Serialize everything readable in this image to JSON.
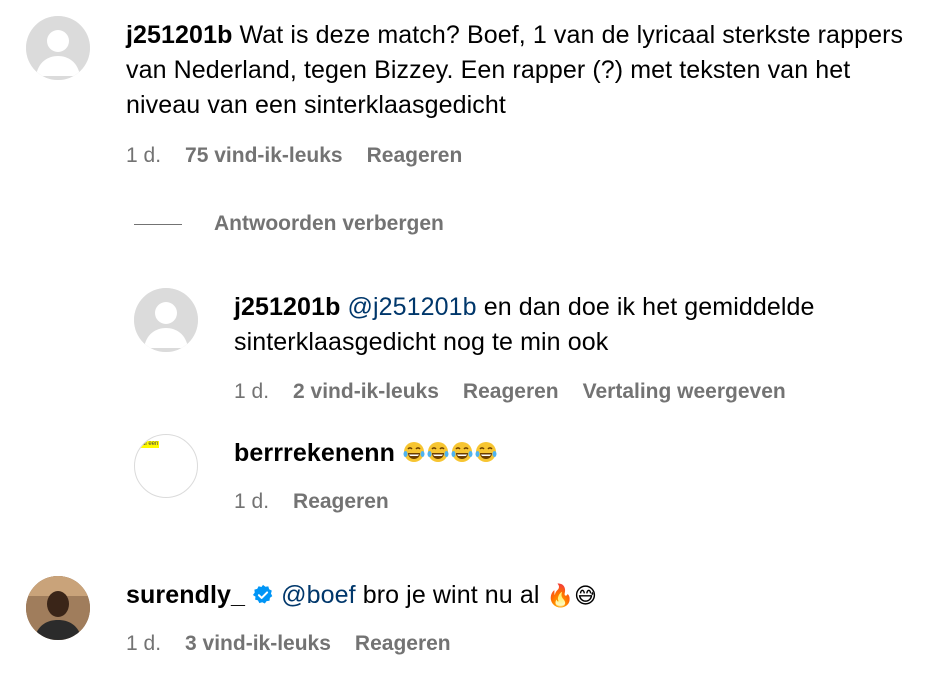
{
  "comments": [
    {
      "username": "j251201b",
      "text": " Wat is deze match? Boef, 1 van de lyricaal sterkste rappers van Nederland, tegen Bizzey. Een rapper (?) met teksten van het niveau van een sinterklaasgedicht",
      "time": "1 d.",
      "likes": "75 vind-ik-leuks",
      "reply": "Reageren"
    }
  ],
  "replies_toggle": "Antwoorden verbergen",
  "replies": [
    {
      "username": "j251201b",
      "mention": "@j251201b",
      "text": " en dan doe ik het gemiddelde sinterklaasgedicht nog te min ook",
      "time": "1 d.",
      "likes": "2 vind-ik-leuks",
      "reply": "Reageren",
      "translate": "Vertaling weergeven"
    },
    {
      "username": "berrrekenenn",
      "emoji": "laughing-tears x4",
      "avatar_text": "al een",
      "time": "1 d.",
      "reply": "Reageren"
    }
  ],
  "comment2": {
    "username": "surendly_",
    "mention": "@boef",
    "text": " bro je wint nu al ",
    "emoji": "🔥😅",
    "time": "1 d.",
    "likes": "3 vind-ik-leuks",
    "reply": "Reageren"
  },
  "colors": {
    "meta": "#737373",
    "mention": "#00376b",
    "verified": "#0095f6"
  }
}
